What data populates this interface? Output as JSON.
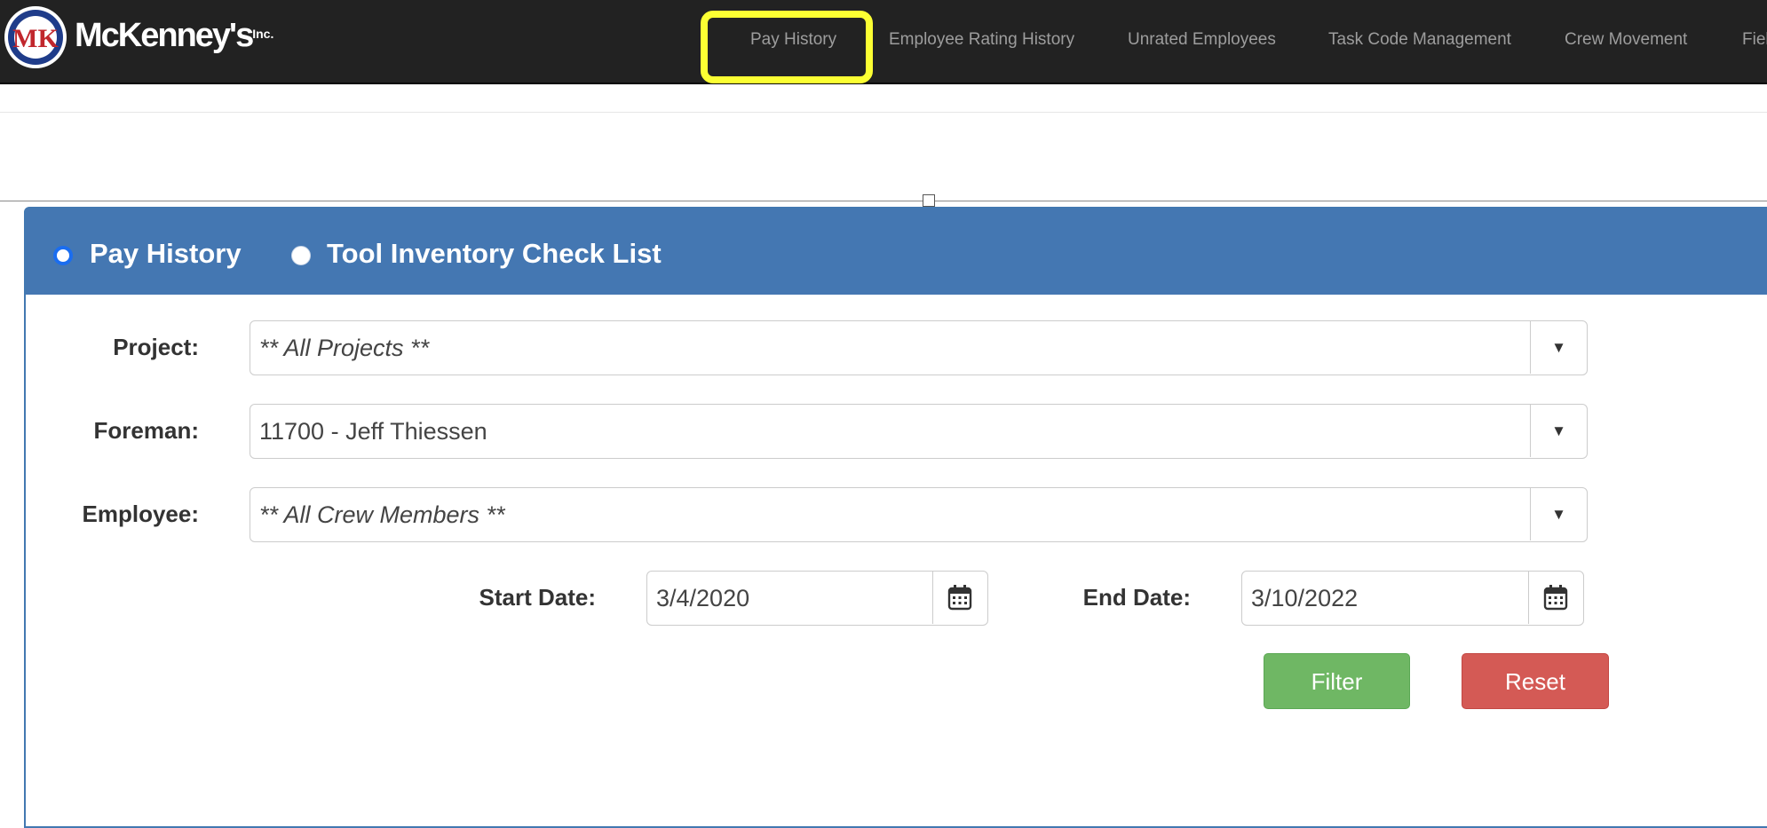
{
  "header": {
    "brand": "McKenney's",
    "brand_suffix": "Inc.",
    "logo_letters": "MK",
    "nav": [
      {
        "label": "Pay History",
        "highlighted": true
      },
      {
        "label": "Employee Rating History"
      },
      {
        "label": "Unrated Employees"
      },
      {
        "label": "Task Code Management"
      },
      {
        "label": "Crew Movement"
      },
      {
        "label": "Fiel"
      }
    ]
  },
  "report_toggle": {
    "options": [
      {
        "label": "Pay History",
        "selected": true
      },
      {
        "label": "Tool Inventory Check List",
        "selected": false
      }
    ]
  },
  "form": {
    "project": {
      "label": "Project:",
      "value": "** All Projects **"
    },
    "foreman": {
      "label": "Foreman:",
      "value": "11700 - Jeff Thiessen"
    },
    "employee": {
      "label": "Employee:",
      "value": "** All Crew Members **"
    },
    "start_date": {
      "label": "Start Date:",
      "value": "3/4/2020"
    },
    "end_date": {
      "label": "End Date:",
      "value": "3/10/2022"
    },
    "filter_label": "Filter",
    "reset_label": "Reset",
    "caret": "▼"
  },
  "colors": {
    "navbar": "#222222",
    "nav_text": "#9d9d9d",
    "highlight": "#fbff33",
    "panel_heading": "#4477b2",
    "filter_button": "#6fb764",
    "reset_button": "#d45a55"
  },
  "icons": {
    "logo": "mk-logo-icon",
    "dropdown": "chevron-down-icon",
    "calendar": "calendar-icon"
  }
}
